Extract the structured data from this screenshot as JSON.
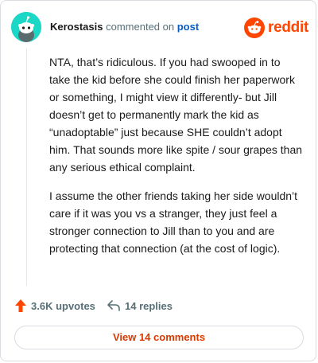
{
  "comment": {
    "author": "Kerostasis",
    "action_text": "commented on",
    "target_link": "post",
    "paragraphs": [
      "NTA, that’s ridiculous. If you had swooped in to take the kid before she could finish her paperwork or something, I might view it differently- but Jill doesn’t get to permanently mark the kid as “unadoptable” just because SHE couldn’t adopt him. That sounds more like spite / sour grapes than any serious ethical complaint.",
      "I assume the other friends taking her side wouldn’t care if it was you vs a stranger, they just feel a stronger connection to Jill than to you and are protecting that connection (at the cost of logic)."
    ]
  },
  "brand": {
    "wordmark": "reddit",
    "color": "#ff4500"
  },
  "stats": {
    "upvotes_label": "3.6K upvotes",
    "replies_label": "14 replies"
  },
  "footer": {
    "view_comments_label": "View 14 comments"
  },
  "icons": {
    "avatar": "snoo-avatar-icon",
    "logo": "reddit-logo-icon",
    "upvote": "upvote-arrow-icon",
    "reply": "reply-arrow-icon"
  },
  "colors": {
    "accent": "#ff4500",
    "avatar_bg": "#1ad7c6",
    "link": "#0a5bc4",
    "muted": "#576f76",
    "button_text": "#d93a00"
  }
}
